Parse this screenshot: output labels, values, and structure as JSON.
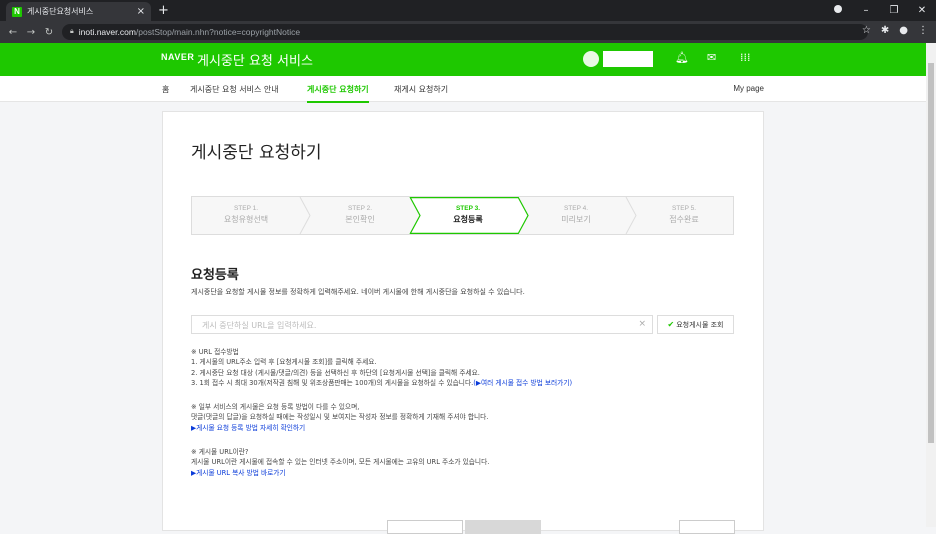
{
  "browser": {
    "tab_title": "게시중단요청서비스",
    "tab_favicon": "N",
    "tab_close": "×",
    "new_tab": "+",
    "url_host": "inoti.naver.com",
    "url_path": "/postStop/main.nhn?notice=copyrightNotice"
  },
  "header": {
    "logo": "NAVER",
    "service_name": "게시중단 요청 서비스"
  },
  "lnb": {
    "items": [
      "홈",
      "게시중단 요청 서비스 안내",
      "게시중단 요청하기",
      "재게시 요청하기"
    ],
    "mypage": "My page"
  },
  "page": {
    "title": "게시중단 요청하기",
    "steps": [
      {
        "num": "STEP 1.",
        "label": "요청유형선택"
      },
      {
        "num": "STEP 2.",
        "label": "본인확인"
      },
      {
        "num": "STEP 3.",
        "label": "요청등록"
      },
      {
        "num": "STEP 4.",
        "label": "미리보기"
      },
      {
        "num": "STEP 5.",
        "label": "접수완료"
      }
    ],
    "active_step": 3,
    "section_title": "요청등록",
    "section_desc": "게시중단을 요청할 게시물 정보를 정확하게 입력해주세요. 네이버 게시물에 한해 게시중단을 요청하실 수 있습니다.",
    "url_placeholder": "게시 중단하실 URL을 입력하세요.",
    "lookup_button": "요청게시물 조회",
    "notes1": {
      "title": "※ URL 접수방법",
      "line1": "1. 게시물의 URL주소 입력 후 [요청게시물 조회]를 클릭해 주세요.",
      "line2": "2. 게시중단 요청 대상 (게시물/댓글/의견) 등을 선택하신 후 하단의 [요청게시물 선택]을 클릭해 주세요.",
      "line3": "3. 1회 접수 시 최대 30개(저작권 침해 및 위조상품판매는 100개)의 게시물을 요청하실 수 있습니다.",
      "line3_link": "(▶여러 게시물 접수 방법 보러가기)"
    },
    "notes2": {
      "title": "※ 일부 서비스의 게시물은 요청 등록 방법이 다를 수 있으며,",
      "line1": "댓글(댓글의 답글)을 요청하실 때에는 작성일시 및 보여지는 작성자 정보를 정확하게 기재해 주셔야 합니다.",
      "link": "▶게시물 요청 등록 방법 자세히 확인하기"
    },
    "notes3": {
      "title": "※ 게시물 URL이란?",
      "line1": "게시물 URL이란 게시물에 접속할 수 있는 인터넷 주소이며, 모든 게시물에는 고유의 URL 주소가 있습니다.",
      "link": "▶게시물 URL 복사 방법 바로가기"
    }
  },
  "colors": {
    "brand": "#1ec800",
    "link": "#0a3bd9"
  }
}
